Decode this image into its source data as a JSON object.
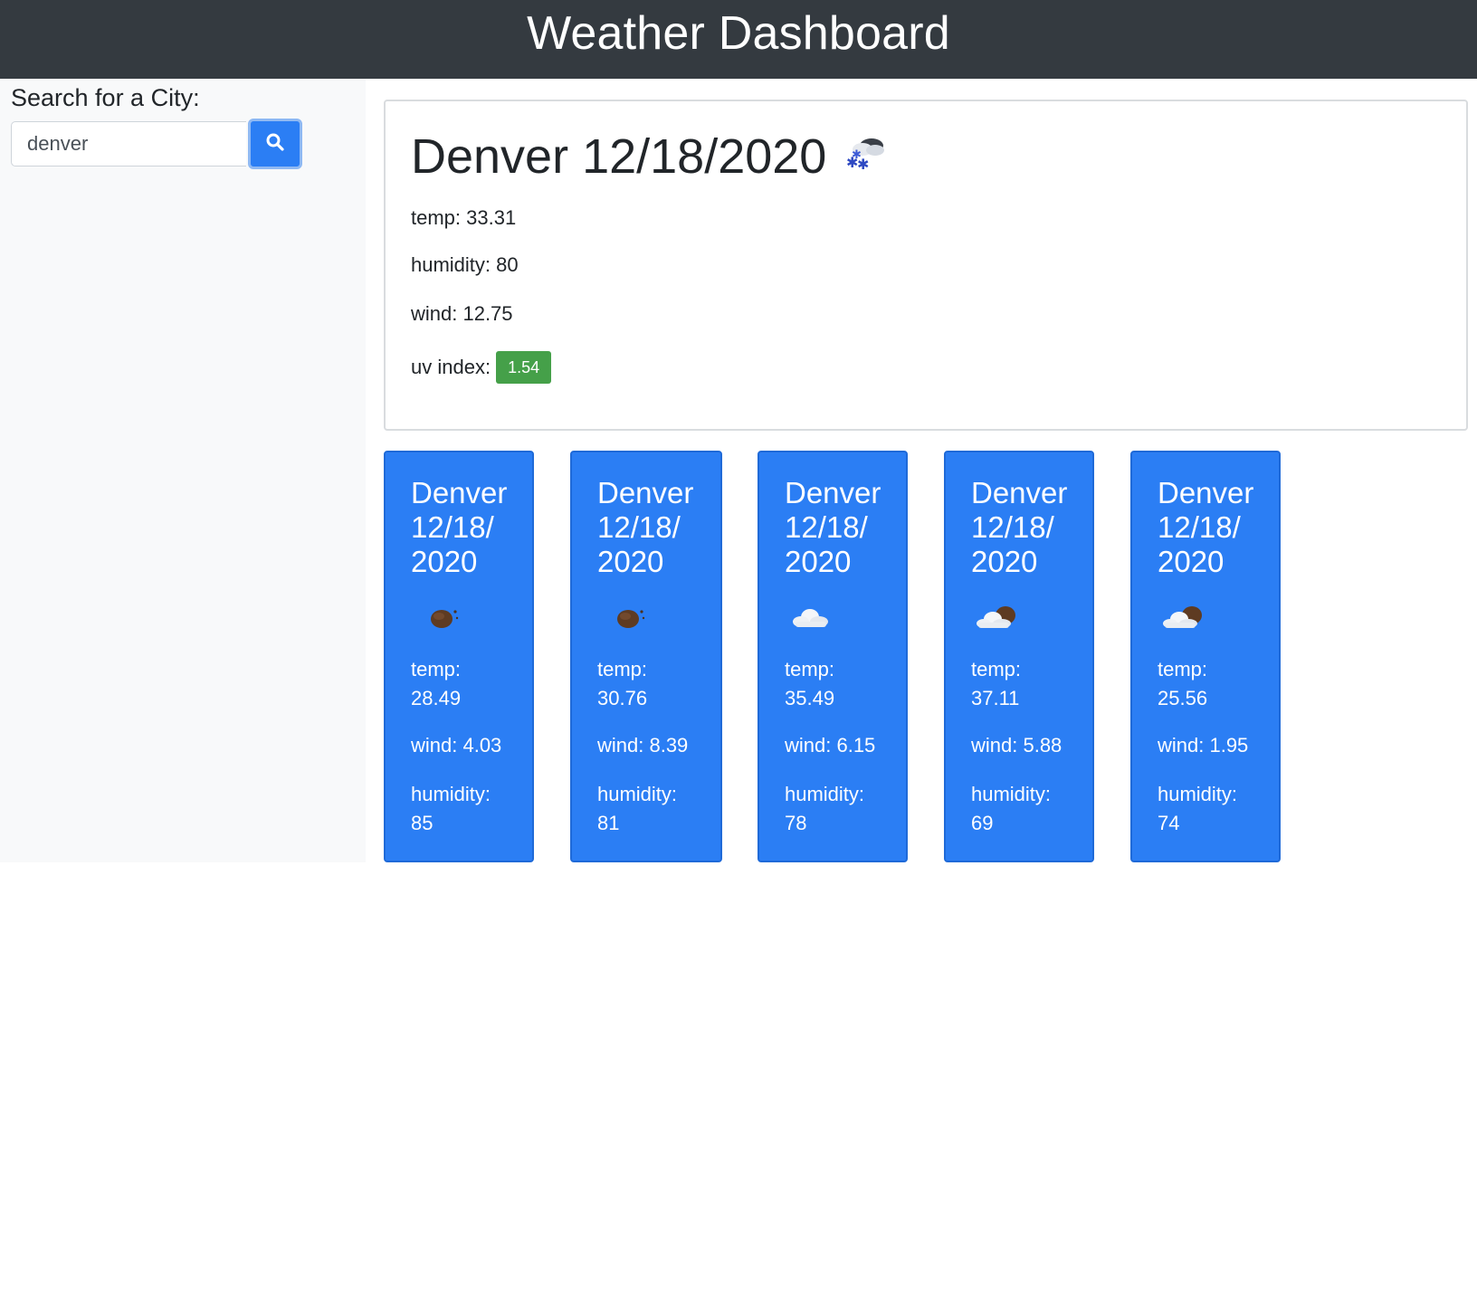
{
  "header": {
    "title": "Weather Dashboard"
  },
  "sidebar": {
    "search_label": "Search for a City:",
    "search_value": "denver",
    "search_button_icon": "search-icon"
  },
  "current": {
    "title": "Denver 12/18/2020",
    "icon": "snow-cloud-icon",
    "temp": "temp: 33.31",
    "humidity": "humidity: 80",
    "wind": "wind: 12.75",
    "uv_label": "uv index:",
    "uv_value": "1.54",
    "uv_color": "#45a049"
  },
  "forecast": [
    {
      "title_line1": "Denver",
      "title_line2": "12/18/",
      "title_line3": "2020",
      "icon": "night-clear-icon",
      "temp_label": "temp:",
      "temp_value": "28.49",
      "wind": "wind: 4.03",
      "humidity_label": "humidity:",
      "humidity_value": "85"
    },
    {
      "title_line1": "Denver",
      "title_line2": "12/18/",
      "title_line3": "2020",
      "icon": "night-clear-icon",
      "temp_label": "temp:",
      "temp_value": "30.76",
      "wind": "wind: 8.39",
      "humidity_label": "humidity:",
      "humidity_value": "81"
    },
    {
      "title_line1": "Denver",
      "title_line2": "12/18/",
      "title_line3": "2020",
      "icon": "cloud-icon",
      "temp_label": "temp:",
      "temp_value": "35.49",
      "wind": "wind: 6.15",
      "humidity_label": "humidity:",
      "humidity_value": "78"
    },
    {
      "title_line1": "Denver",
      "title_line2": "12/18/",
      "title_line3": "2020",
      "icon": "partly-cloudy-night-icon",
      "temp_label": "temp:",
      "temp_value": "37.11",
      "wind": "wind: 5.88",
      "humidity_label": "humidity:",
      "humidity_value": "69"
    },
    {
      "title_line1": "Denver",
      "title_line2": "12/18/",
      "title_line3": "2020",
      "icon": "partly-cloudy-night-icon",
      "temp_label": "temp:",
      "temp_value": "25.56",
      "wind": "wind: 1.95",
      "humidity_label": "humidity:",
      "humidity_value": "74"
    }
  ],
  "colors": {
    "header_bg": "#343a40",
    "card_blue": "#2b7ef4",
    "sidebar_bg": "#f8f9fa"
  }
}
